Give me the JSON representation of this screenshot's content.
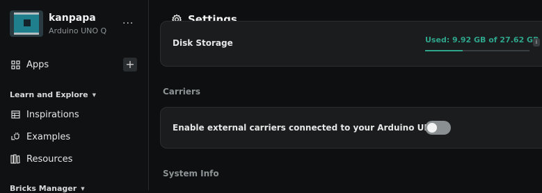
{
  "device": {
    "name": "kanpapa",
    "model": "Arduino UNO Q",
    "menu_label": "···"
  },
  "sidebar": {
    "apps_label": "Apps",
    "add_label": "+",
    "learn_section": "Learn and Explore",
    "learn_items": [
      {
        "label": "Inspirations",
        "icon": "table-icon"
      },
      {
        "label": "Examples",
        "icon": "plug-icon"
      },
      {
        "label": "Resources",
        "icon": "books-icon"
      }
    ],
    "bricks_section": "Bricks Manager"
  },
  "header": {
    "title": "Settings",
    "icon": "gear-icon"
  },
  "storage": {
    "label": "Disk Storage",
    "used_text": "Used: 9.92 GB of 27.62 GB",
    "fraction": 0.36,
    "badge": "i"
  },
  "carriers": {
    "heading": "Carriers",
    "toggle_label": "Enable external carriers connected to your Arduino UNO Q",
    "enabled": false
  },
  "system_info": {
    "heading": "System Info"
  },
  "colors": {
    "accent": "#2fa58c",
    "background": "#0d0f10",
    "card": "#1a1c1d"
  }
}
